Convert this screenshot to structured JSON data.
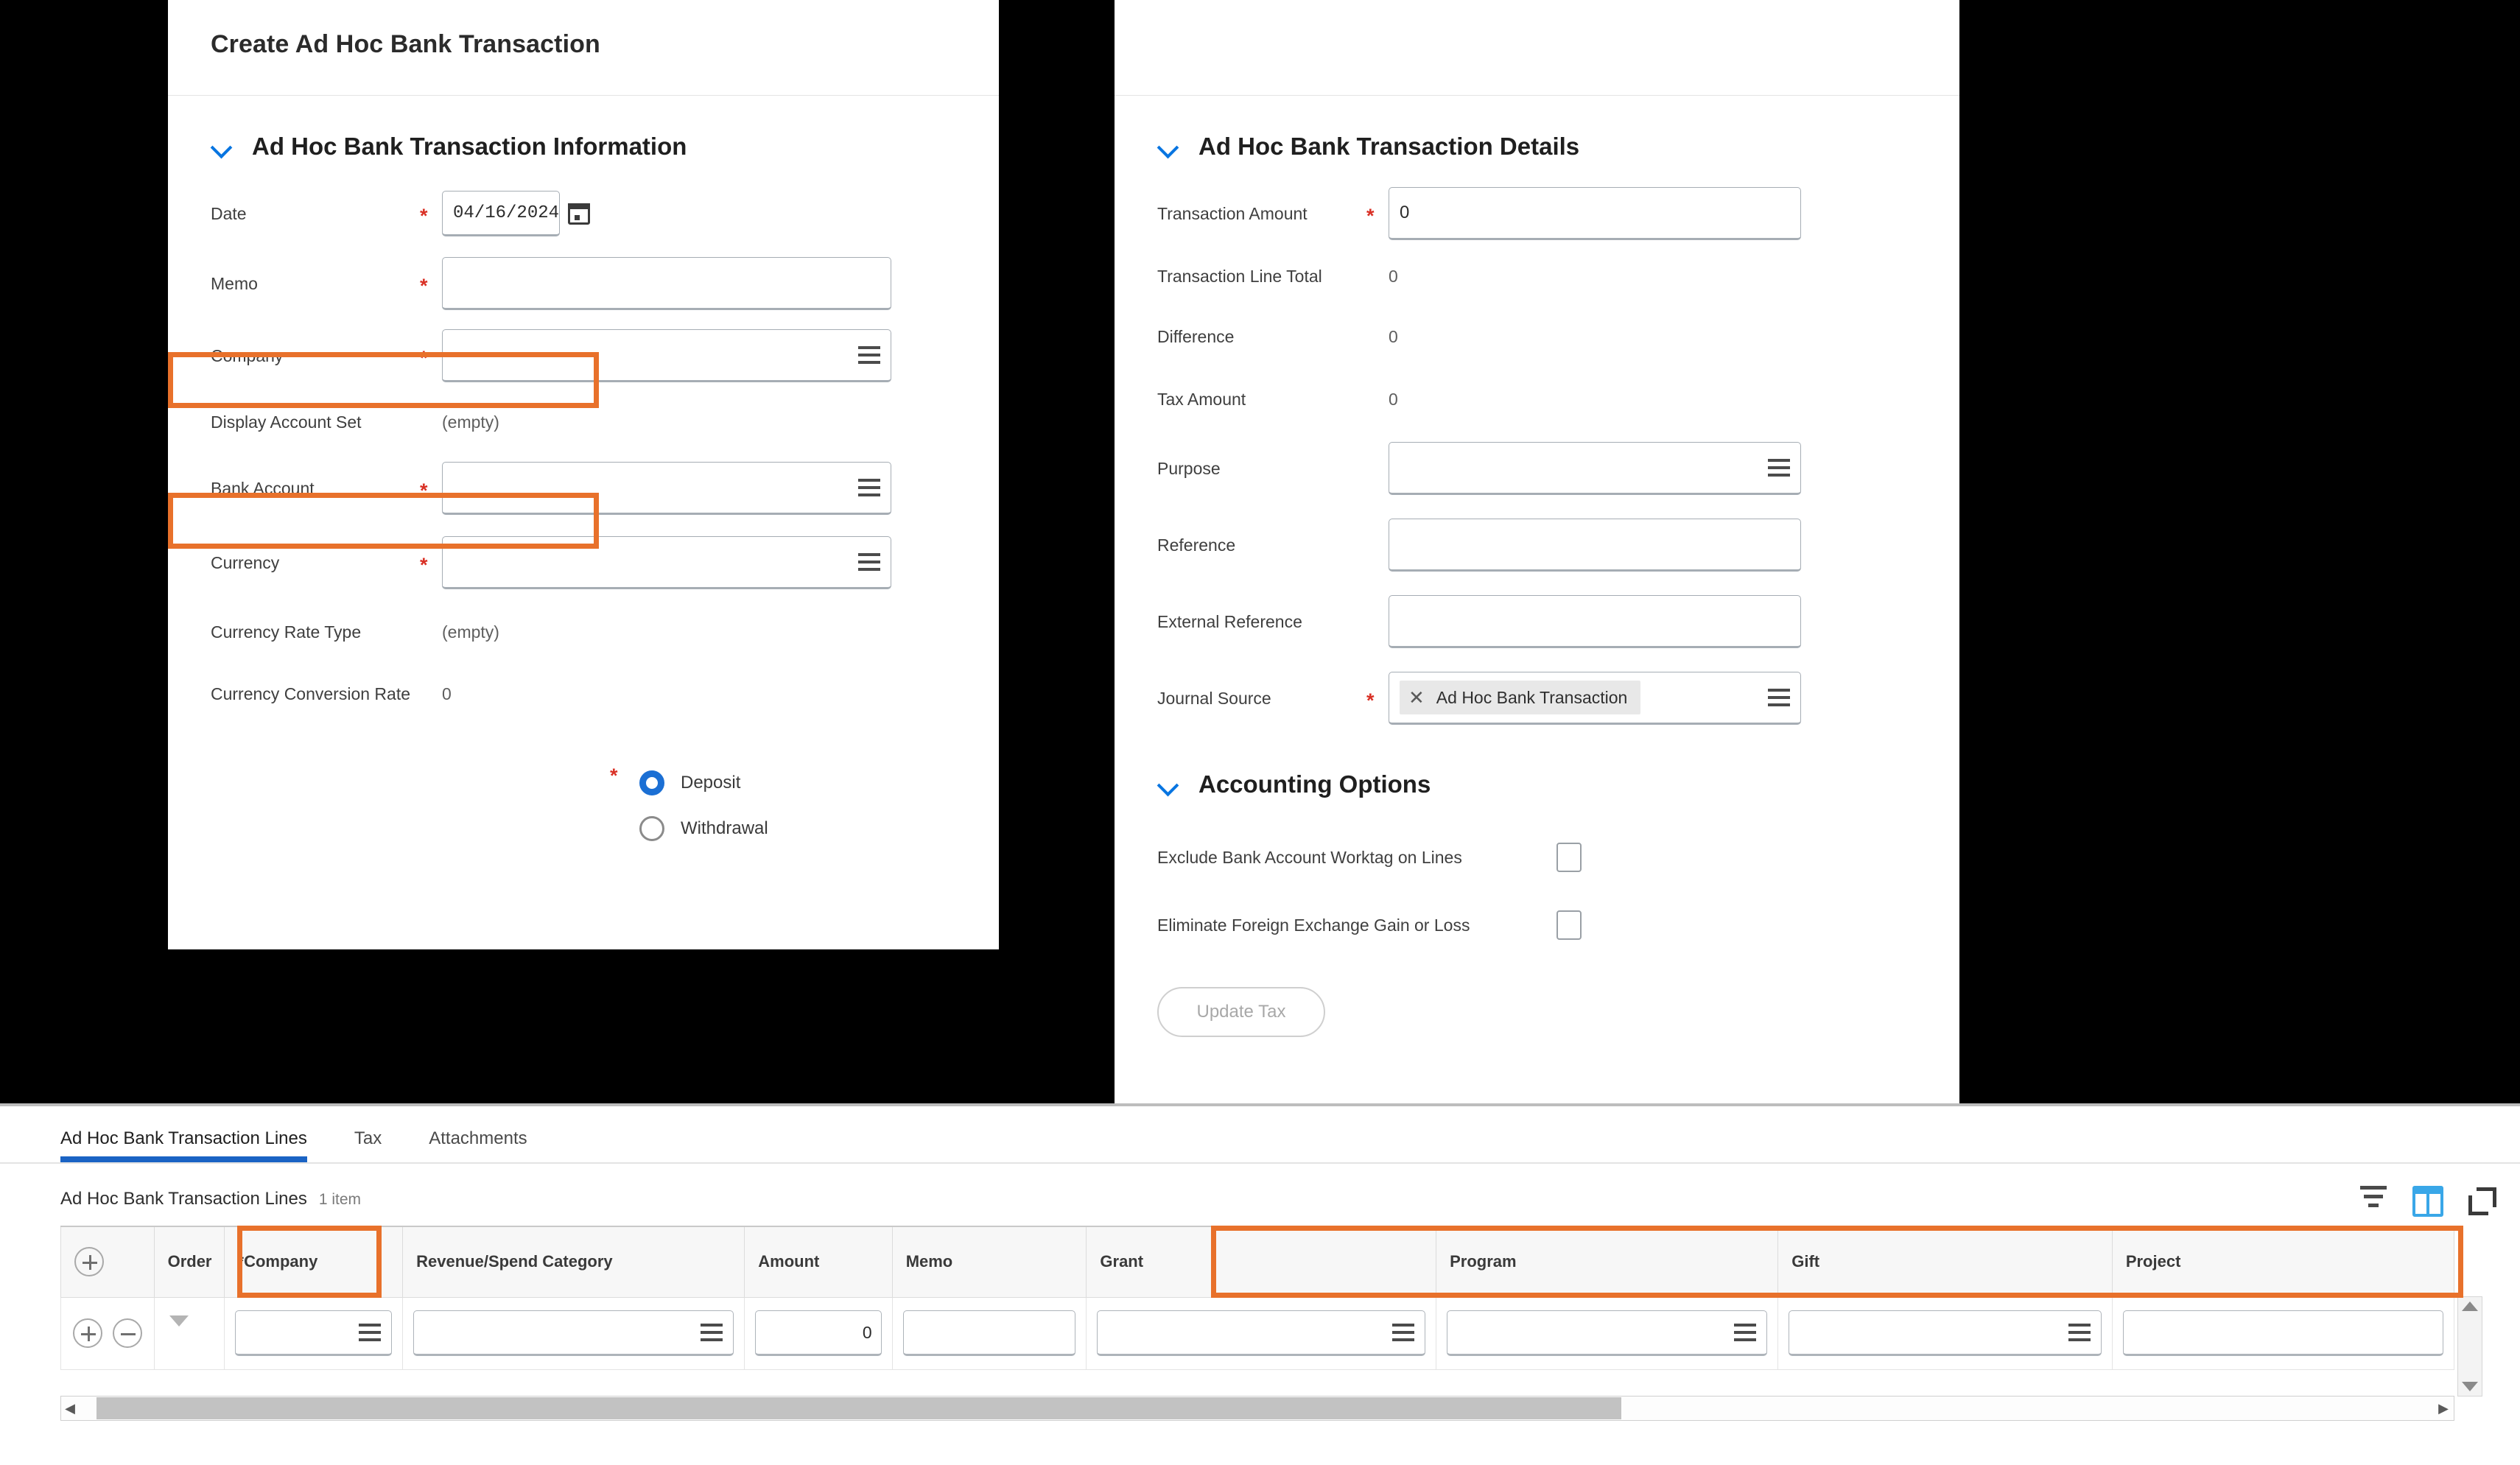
{
  "left_panel": {
    "title": "Create Ad Hoc Bank Transaction",
    "section_title": "Ad Hoc Bank Transaction Information",
    "fields": {
      "date_label": "Date",
      "date_value": "04/16/2024",
      "memo_label": "Memo",
      "memo_value": "",
      "company_label": "Company",
      "company_value": "",
      "display_account_set_label": "Display Account Set",
      "display_account_set_value": "(empty)",
      "bank_account_label": "Bank Account",
      "bank_account_value": "",
      "currency_label": "Currency",
      "currency_value": "",
      "currency_rate_type_label": "Currency Rate Type",
      "currency_rate_type_value": "(empty)",
      "currency_conversion_rate_label": "Currency Conversion Rate",
      "currency_conversion_rate_value": "0"
    },
    "radio": {
      "deposit_label": "Deposit",
      "withdrawal_label": "Withdrawal",
      "selected": "Deposit"
    }
  },
  "right_panel": {
    "section_title": "Ad Hoc Bank Transaction Details",
    "fields": {
      "transaction_amount_label": "Transaction Amount",
      "transaction_amount_value": "0",
      "transaction_line_total_label": "Transaction Line Total",
      "transaction_line_total_value": "0",
      "difference_label": "Difference",
      "difference_value": "0",
      "tax_amount_label": "Tax Amount",
      "tax_amount_value": "0",
      "purpose_label": "Purpose",
      "purpose_value": "",
      "reference_label": "Reference",
      "reference_value": "",
      "external_reference_label": "External Reference",
      "external_reference_value": "",
      "journal_source_label": "Journal Source",
      "journal_source_token": "Ad Hoc Bank Transaction"
    },
    "accounting_options": {
      "title": "Accounting Options",
      "exclude_worktag_label": "Exclude Bank Account Worktag on Lines",
      "eliminate_fx_label": "Eliminate Foreign Exchange Gain or Loss",
      "update_tax_button": "Update Tax"
    }
  },
  "bottom_panel": {
    "tabs": [
      {
        "label": "Ad Hoc Bank Transaction Lines",
        "active": true
      },
      {
        "label": "Tax",
        "active": false
      },
      {
        "label": "Attachments",
        "active": false
      }
    ],
    "grid_caption": "Ad Hoc Bank Transaction Lines",
    "grid_count": "1 item",
    "columns": [
      "Order",
      "*Company",
      "Revenue/Spend Category",
      "Amount",
      "Memo",
      "Grant",
      "Program",
      "Gift",
      "Project"
    ],
    "row": {
      "order": "",
      "company": "",
      "revenue_spend_category": "",
      "amount": "0",
      "memo": "",
      "grant": "",
      "program": "",
      "gift": "",
      "project": ""
    }
  },
  "colors": {
    "highlight": "#e8712b",
    "accent_blue": "#1a63c4",
    "required_red": "#d93025"
  }
}
